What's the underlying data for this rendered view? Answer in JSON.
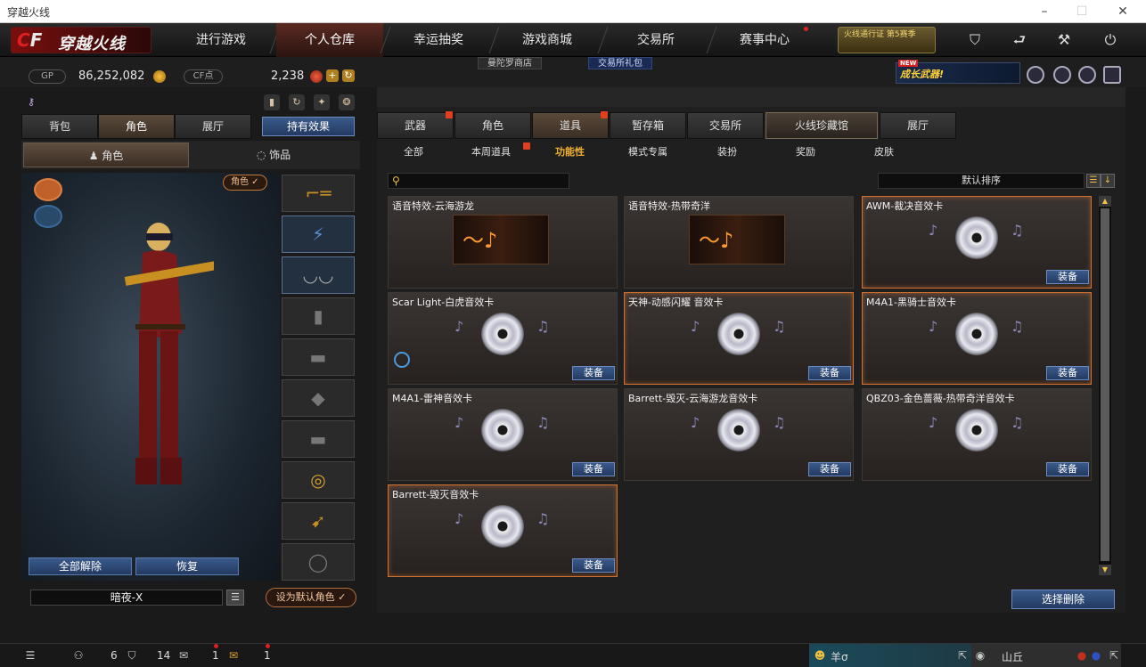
{
  "window": {
    "title": "穿越火线",
    "controls": [
      "minimize",
      "maximize",
      "close"
    ]
  },
  "logo": {
    "cf": "CF",
    "name": "穿越火线"
  },
  "nav": {
    "tabs": [
      {
        "label": "进行游戏",
        "active": false
      },
      {
        "label": "个人仓库",
        "active": true
      },
      {
        "label": "幸运抽奖",
        "active": false
      },
      {
        "label": "游戏商城",
        "active": false
      },
      {
        "label": "交易所",
        "active": false
      },
      {
        "label": "赛事中心",
        "active": false
      }
    ],
    "pass_text": "火线通行证 第5赛季",
    "icons": [
      "shield-icon",
      "back-icon",
      "wrench-icon",
      "power-icon"
    ]
  },
  "stores": {
    "store1": "曼陀罗商店",
    "store2": "交易所礼包"
  },
  "currency": {
    "gp_label": "GP",
    "gp_value": "86,252,082",
    "cf_label": "CF点",
    "cf_value": "2,238"
  },
  "banner": {
    "new": "NEW",
    "text": "成长武器!"
  },
  "left": {
    "tabs": [
      {
        "label": "背包",
        "active": false
      },
      {
        "label": "角色",
        "active": true
      },
      {
        "label": "展厅",
        "active": false
      }
    ],
    "hold_effect": "持有效果",
    "subtabs": [
      {
        "label": "角色",
        "active": true
      },
      {
        "label": "饰品",
        "active": false
      }
    ],
    "role_tag": "角色 ✓",
    "unequip_all": "全部解除",
    "restore": "恢复",
    "character_name": "暗夜-X",
    "set_default": "设为默认角色 ✓"
  },
  "right": {
    "tabs": [
      {
        "label": "武器",
        "gift": true
      },
      {
        "label": "角色",
        "gift": false
      },
      {
        "label": "道具",
        "gift": true,
        "active": true
      },
      {
        "label": "暂存箱",
        "gift": false
      },
      {
        "label": "交易所",
        "gift": false
      },
      {
        "label": "火线珍藏馆",
        "gift": false,
        "collect": true
      },
      {
        "label": "展厅",
        "gift": false
      }
    ],
    "categories": [
      {
        "label": "全部",
        "active": false
      },
      {
        "label": "本周道具",
        "active": false,
        "gift": true
      },
      {
        "label": "功能性",
        "active": true
      },
      {
        "label": "模式专属",
        "active": false
      },
      {
        "label": "装扮",
        "active": false
      },
      {
        "label": "奖励",
        "active": false
      },
      {
        "label": "皮肤",
        "active": false
      }
    ],
    "search_placeholder": "",
    "sort_label": "默认排序",
    "items": [
      {
        "title": "语音特效-云海游龙",
        "kind": "thumb",
        "highlight": false,
        "equip": ""
      },
      {
        "title": "语音特效-热带奇洋",
        "kind": "thumb",
        "highlight": false,
        "equip": ""
      },
      {
        "title": "AWM-裁决音效卡",
        "kind": "disc",
        "highlight": true,
        "equip": "装备"
      },
      {
        "title": "Scar Light-白虎音效卡",
        "kind": "disc",
        "highlight": false,
        "equip": "装备",
        "badge": true
      },
      {
        "title": "天神-动感闪耀 音效卡",
        "kind": "disc",
        "highlight": true,
        "equip": "装备"
      },
      {
        "title": "M4A1-黑骑士音效卡",
        "kind": "disc",
        "highlight": true,
        "equip": "装备"
      },
      {
        "title": "M4A1-雷神音效卡",
        "kind": "disc",
        "highlight": false,
        "equip": "装备"
      },
      {
        "title": "Barrett-毁灭-云海游龙音效卡",
        "kind": "disc",
        "highlight": false,
        "equip": "装备"
      },
      {
        "title": "QBZ03-金色蔷薇-热带奇洋音效卡",
        "kind": "disc",
        "highlight": false,
        "equip": "装备"
      },
      {
        "title": "Barrett-毁灭音效卡",
        "kind": "disc",
        "highlight": true,
        "equip": "装备"
      }
    ],
    "delete_btn": "选择删除"
  },
  "bottom": {
    "count1": "6",
    "count2": "14",
    "count3": "1",
    "count4": "1",
    "friend1": "羊σ",
    "friend2": "山丘"
  }
}
